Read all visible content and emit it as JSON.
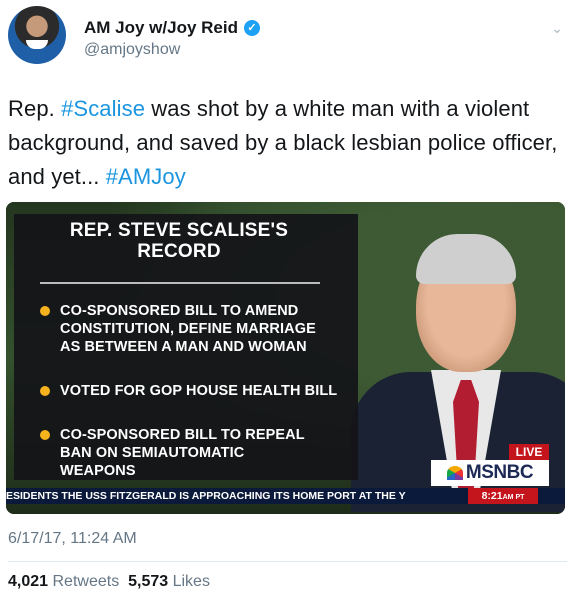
{
  "tweet": {
    "display_name": "AM Joy w/Joy Reid",
    "handle": "@amjoyshow",
    "text_part1": "Rep. ",
    "hashtag1": "#Scalise",
    "text_part2": " was shot by a white man with a violent background, and saved by a black lesbian police officer, and yet... ",
    "hashtag2": "#AMJoy",
    "timestamp": "6/17/17, 11:24 AM",
    "retweets_count": "4,021",
    "retweets_label": "Retweets",
    "likes_count": "5,573",
    "likes_label": "Likes"
  },
  "media": {
    "graphic_title_line1": "REP. STEVE SCALISE'S",
    "graphic_title_line2": "RECORD",
    "bullets": [
      "CO-SPONSORED BILL TO AMEND CONSTITUTION, DEFINE MARRIAGE AS BETWEEN A MAN AND WOMAN",
      "VOTED FOR GOP HOUSE HEALTH BILL",
      "CO-SPONSORED BILL TO REPEAL BAN ON SEMIAUTOMATIC WEAPONS"
    ],
    "live_label": "LIVE",
    "network": "MSNBC",
    "ticker": "ESIDENTS  THE USS FITZGERALD IS APPROACHING ITS HOME PORT AT THE Y",
    "clock": "8:21",
    "clock_suffix": "AM PT"
  },
  "icons": [
    "verified-icon",
    "chevron-down-icon",
    "peacock-logo-icon"
  ],
  "colors": {
    "link": "#1b95e0",
    "verified": "#1da1f2",
    "muted": "#657786",
    "bullet": "#f5b21d",
    "live_red": "#c4151c"
  }
}
